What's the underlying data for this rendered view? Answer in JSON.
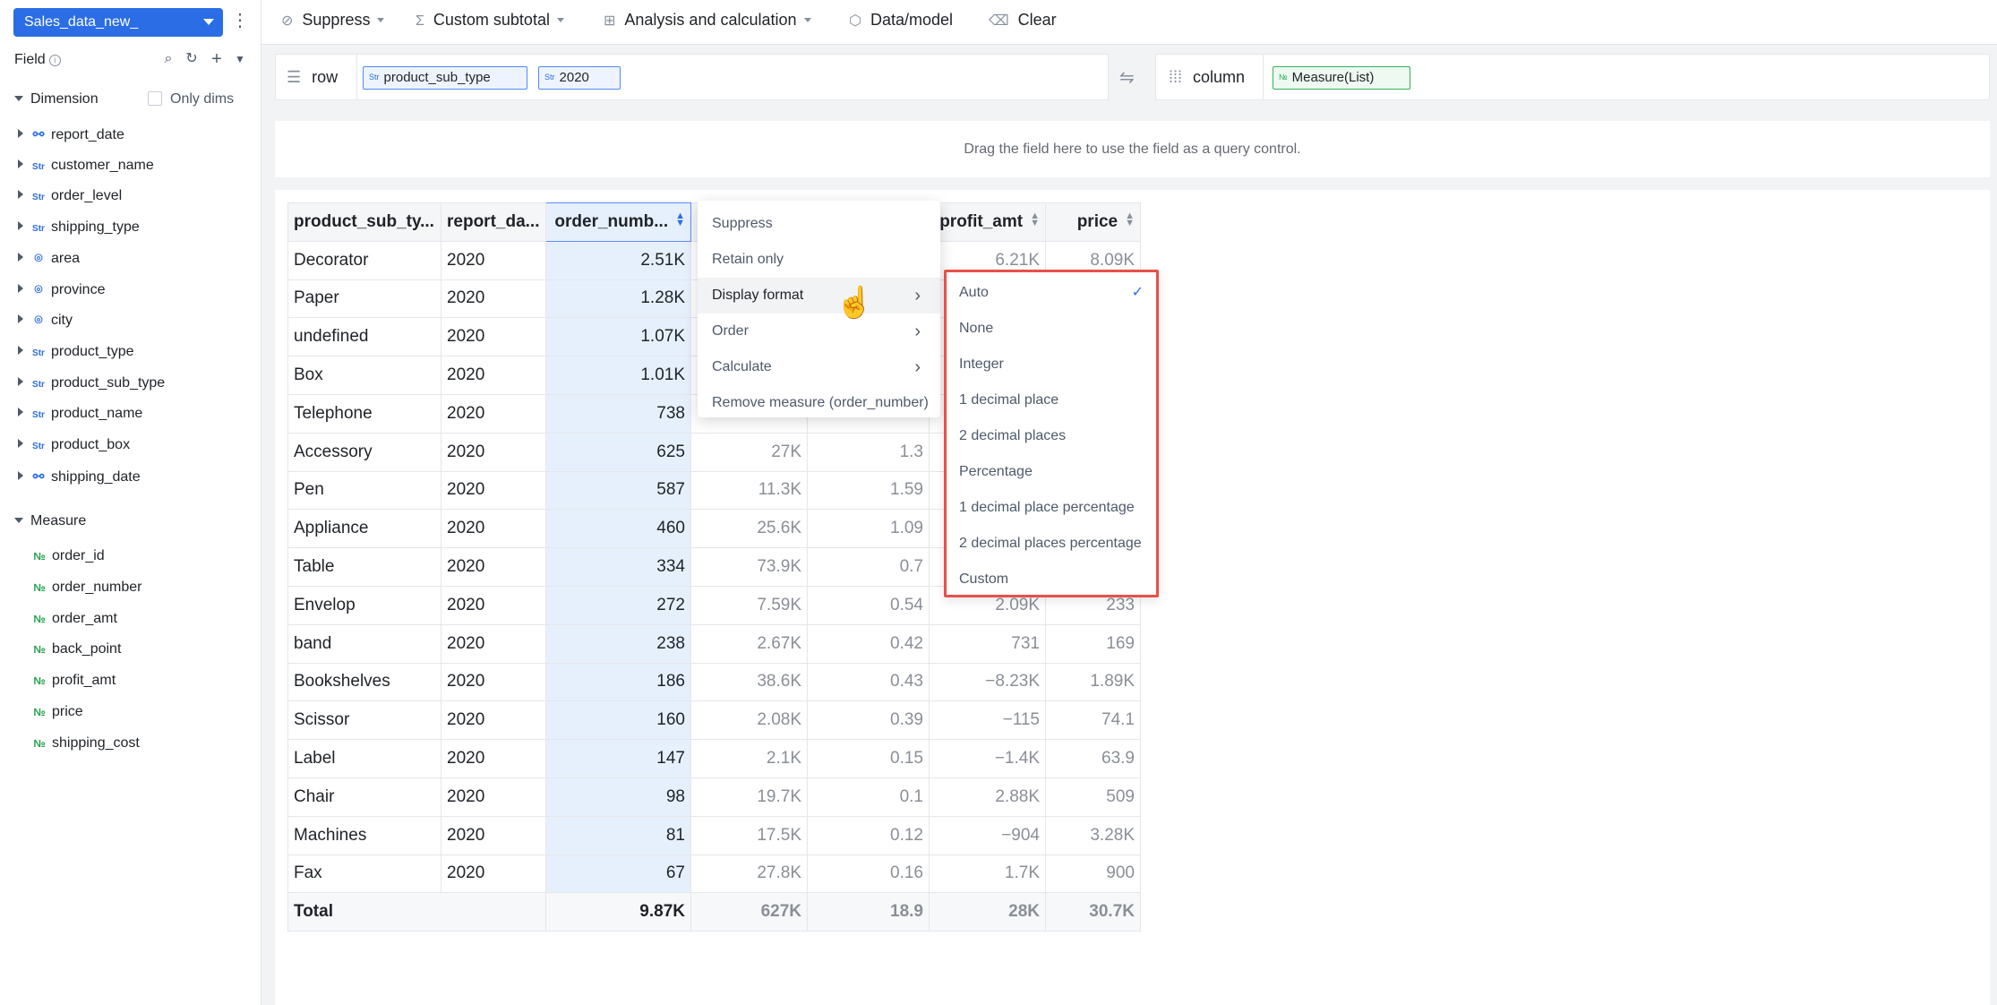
{
  "sidebar": {
    "dataset": "Sales_data_new_",
    "field_title": "Field",
    "dimension_title": "Dimension",
    "only_dims_label": "Only dims",
    "dimensions": [
      {
        "label": "report_date",
        "type": "hierarchy-icon"
      },
      {
        "label": "customer_name",
        "type": "str"
      },
      {
        "label": "order_level",
        "type": "str"
      },
      {
        "label": "shipping_type",
        "type": "str"
      },
      {
        "label": "area",
        "type": "geo-icon"
      },
      {
        "label": "province",
        "type": "geo-icon"
      },
      {
        "label": "city",
        "type": "geo-icon"
      },
      {
        "label": "product_type",
        "type": "str"
      },
      {
        "label": "product_sub_type",
        "type": "str"
      },
      {
        "label": "product_name",
        "type": "str"
      },
      {
        "label": "product_box",
        "type": "str"
      },
      {
        "label": "shipping_date",
        "type": "hierarchy-icon"
      }
    ],
    "measure_title": "Measure",
    "measures": [
      "order_id",
      "order_number",
      "order_amt",
      "back_point",
      "profit_amt",
      "price",
      "shipping_cost"
    ]
  },
  "toolbar": {
    "suppress": "Suppress",
    "custom_subtotal": "Custom subtotal",
    "analysis": "Analysis and calculation",
    "data_model": "Data/model",
    "clear": "Clear"
  },
  "shelves": {
    "row_label": "row",
    "row_pills": [
      "product_sub_type",
      "2020"
    ],
    "column_label": "column",
    "column_pills": [
      "Measure(List)"
    ]
  },
  "dropzone_text": "Drag the field here to use the field as a query control.",
  "table": {
    "headers": [
      "product_sub_ty...",
      "report_da...",
      "order_numb...",
      "",
      "",
      "profit_amt",
      "price"
    ],
    "rows": [
      [
        "Decorator",
        "2020",
        "2.51K",
        "",
        "",
        "6.21K",
        "8.09K"
      ],
      [
        "Paper",
        "2020",
        "1.28K",
        "",
        "",
        "",
        ""
      ],
      [
        "undefined",
        "2020",
        "1.07K",
        "",
        "",
        "",
        ""
      ],
      [
        "Box",
        "2020",
        "1.01K",
        "",
        "",
        "",
        ""
      ],
      [
        "Telephone",
        "2020",
        "738",
        "",
        "",
        "",
        ""
      ],
      [
        "Accessory",
        "2020",
        "625",
        "27K",
        "1.3",
        "",
        ""
      ],
      [
        "Pen",
        "2020",
        "587",
        "11.3K",
        "1.59",
        "",
        ""
      ],
      [
        "Appliance",
        "2020",
        "460",
        "25.6K",
        "1.09",
        "",
        ""
      ],
      [
        "Table",
        "2020",
        "334",
        "73.9K",
        "0.7",
        "",
        ""
      ],
      [
        "Envelop",
        "2020",
        "272",
        "7.59K",
        "0.54",
        "2.09K",
        "233"
      ],
      [
        "band",
        "2020",
        "238",
        "2.67K",
        "0.42",
        "731",
        "169"
      ],
      [
        "Bookshelves",
        "2020",
        "186",
        "38.6K",
        "0.43",
        "−8.23K",
        "1.89K"
      ],
      [
        "Scissor",
        "2020",
        "160",
        "2.08K",
        "0.39",
        "−115",
        "74.1"
      ],
      [
        "Label",
        "2020",
        "147",
        "2.1K",
        "0.15",
        "−1.4K",
        "63.9"
      ],
      [
        "Chair",
        "2020",
        "98",
        "19.7K",
        "0.1",
        "2.88K",
        "509"
      ],
      [
        "Machines",
        "2020",
        "81",
        "17.5K",
        "0.12",
        "−904",
        "3.28K"
      ],
      [
        "Fax",
        "2020",
        "67",
        "27.8K",
        "0.16",
        "1.7K",
        "900"
      ]
    ],
    "total_label": "Total",
    "total_values": [
      "9.87K",
      "627K",
      "18.9",
      "28K",
      "30.7K"
    ]
  },
  "context_menu": {
    "items": [
      {
        "label": "Suppress",
        "submenu": false
      },
      {
        "label": "Retain only",
        "submenu": false
      },
      {
        "label": "Display format",
        "submenu": true
      },
      {
        "label": "Order",
        "submenu": true
      },
      {
        "label": "Calculate",
        "submenu": true
      },
      {
        "label": "Remove measure (order_number)",
        "submenu": false
      }
    ],
    "active_index": 2
  },
  "display_format_menu": {
    "items": [
      "Auto",
      "None",
      "Integer",
      "1 decimal place",
      "2 decimal places",
      "Percentage",
      "1 decimal place percentage",
      "2 decimal places percentage",
      "Custom"
    ],
    "checked_index": 0
  },
  "colors": {
    "accent": "#2b6de5",
    "highlight_border": "#e8514a",
    "selected_column": "#e6f0fd",
    "measure_green": "#22a34a"
  }
}
